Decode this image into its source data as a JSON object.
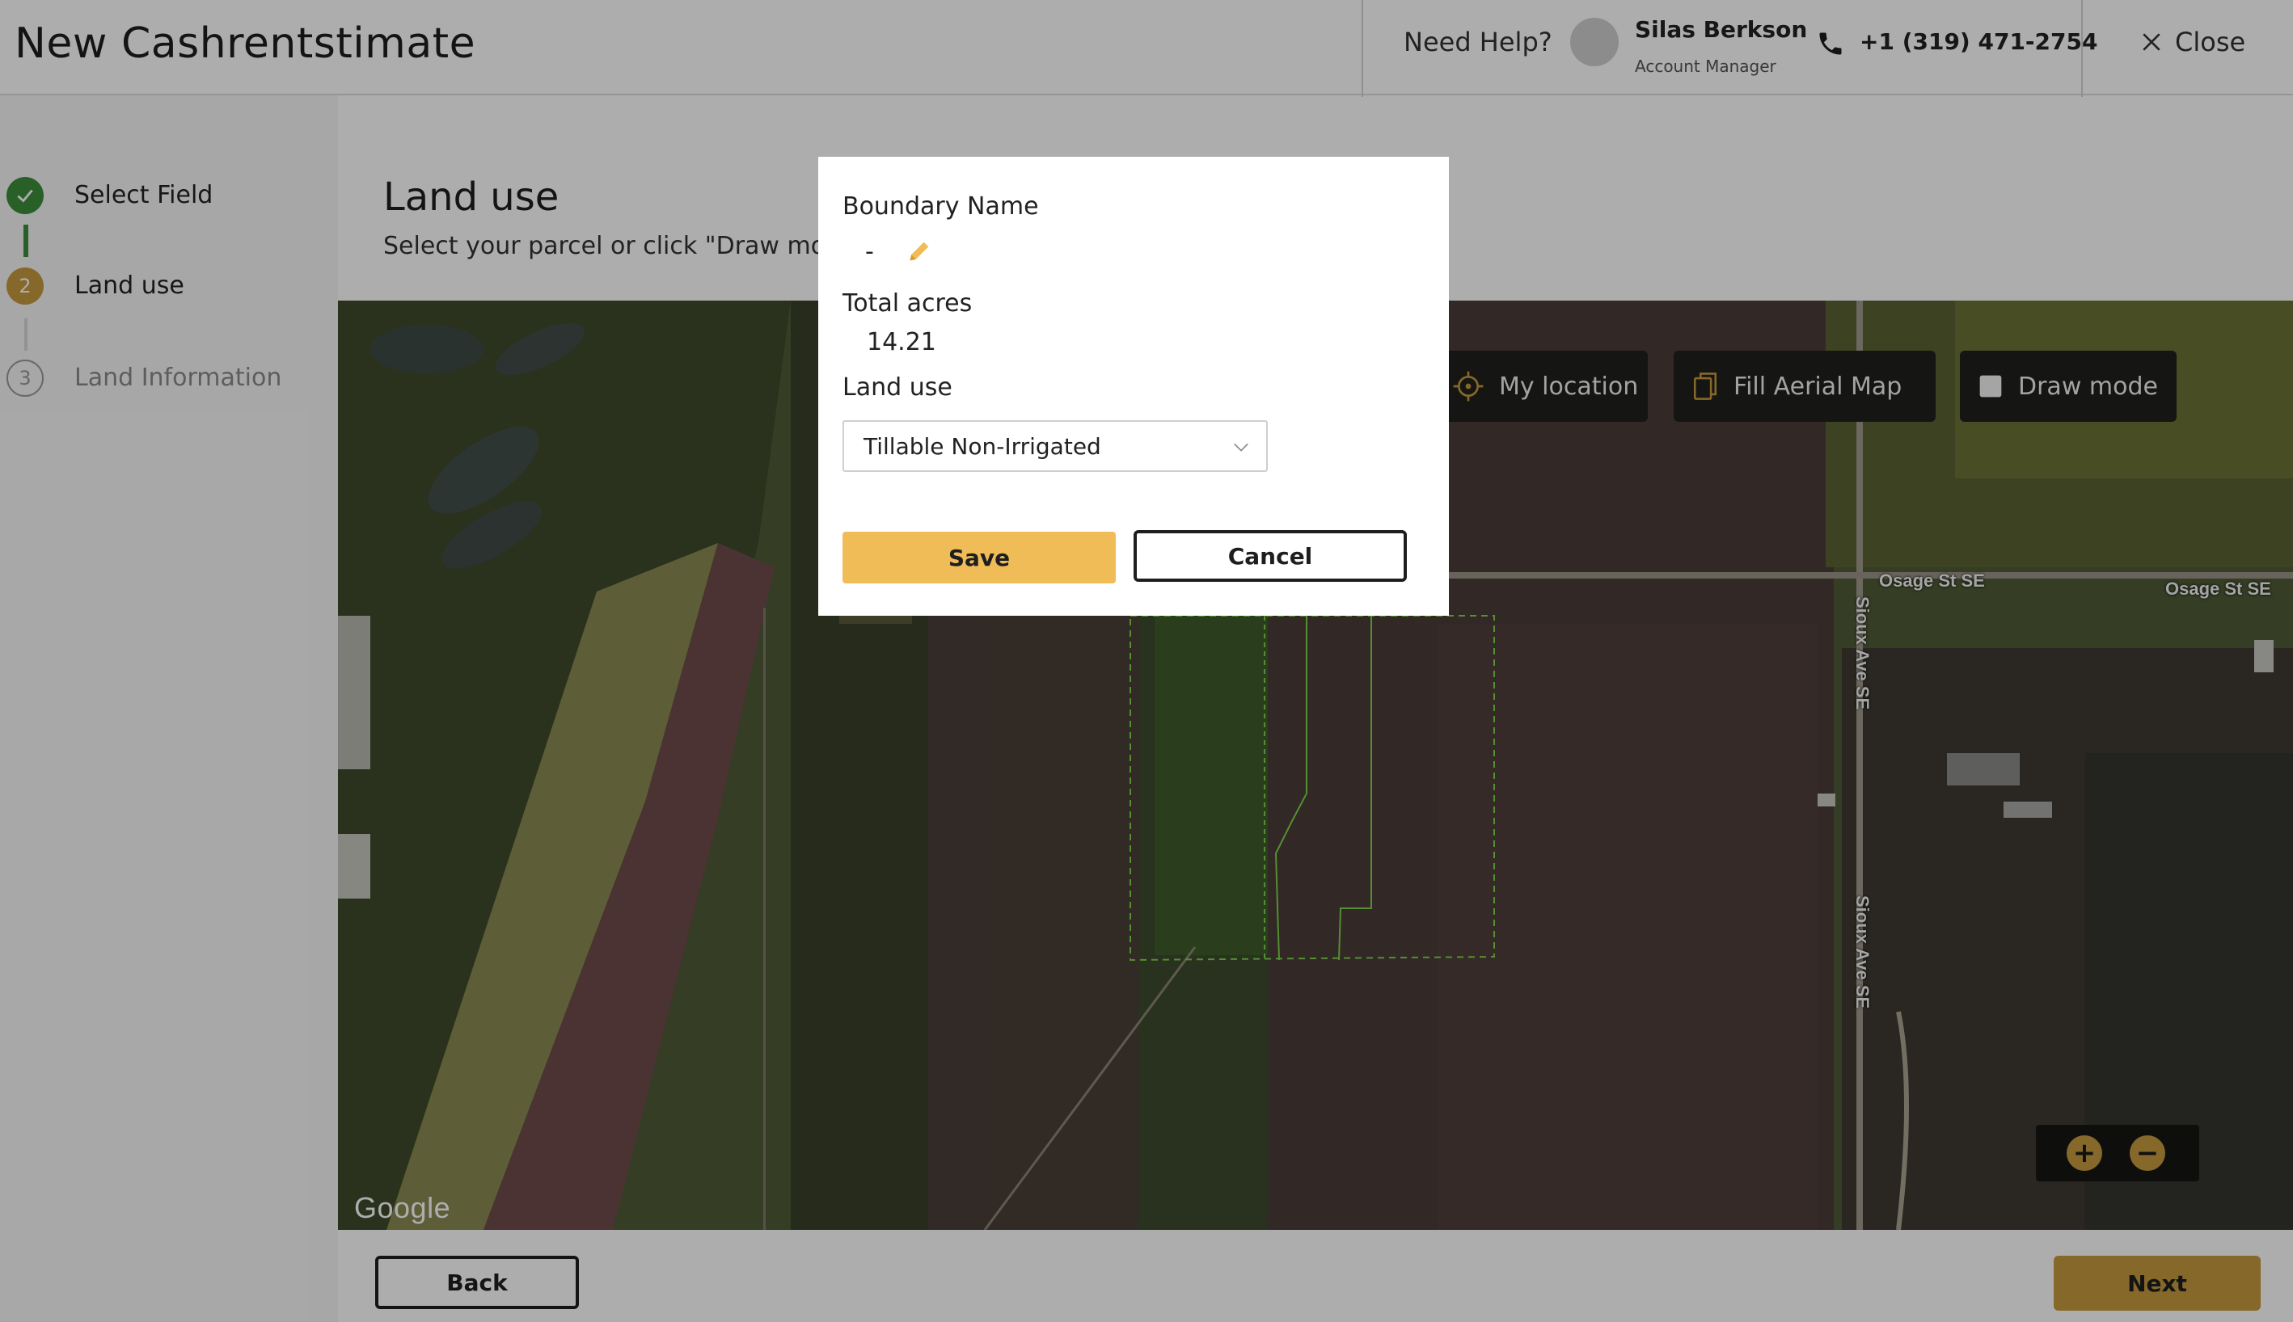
{
  "app": {
    "title": "New Cashrentstimate"
  },
  "header": {
    "help_label": "Need Help?",
    "manager_name": "Silas Berkson",
    "manager_role": "Account Manager",
    "phone": "+1 (319) 471-2754",
    "close_label": "Close"
  },
  "steps": [
    {
      "number": "",
      "label": "Select Field",
      "state": "done"
    },
    {
      "number": "2",
      "label": "Land use",
      "state": "active"
    },
    {
      "number": "3",
      "label": "Land Information",
      "state": "pending"
    }
  ],
  "main": {
    "title": "Land use",
    "subtitle": "Select your parcel or click \"Draw mode\" to define your field."
  },
  "map": {
    "my_location_label": "My location",
    "fill_aerial_label": "Fill Aerial Map",
    "draw_mode_label": "Draw mode",
    "zoom_in": "+",
    "zoom_out": "−",
    "logo": "Google",
    "roads": {
      "osage_1": "Osage St SE",
      "osage_2": "Osage St SE",
      "sioux_1": "Sioux Ave SE",
      "sioux_2": "Sioux Ave SE"
    }
  },
  "modal": {
    "boundary_name_label": "Boundary Name",
    "boundary_name_value": "-",
    "total_acres_label": "Total acres",
    "total_acres_value": "14.21",
    "land_use_label": "Land use",
    "land_use_selected": "Tillable Non-Irrigated",
    "save_label": "Save",
    "cancel_label": "Cancel"
  },
  "footer": {
    "back_label": "Back",
    "next_label": "Next"
  },
  "colors": {
    "accent": "#F0BC58",
    "next_button": "#C59A3E",
    "step_done": "#3B8E3B",
    "step_active": "#C59A3E",
    "boundary_line": "#7CD34A"
  }
}
